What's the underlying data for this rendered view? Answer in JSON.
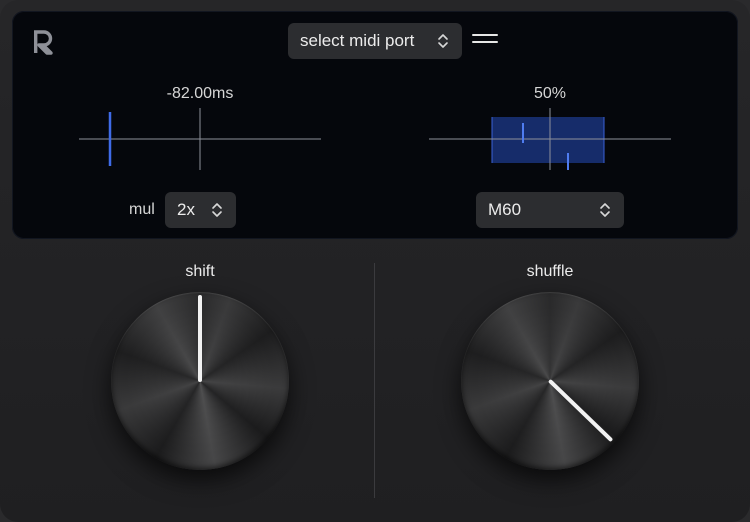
{
  "header": {
    "logo_text": "R",
    "midi_port": {
      "selected": "select midi port"
    },
    "menu_icon": "hamburger-icon"
  },
  "shift_panel": {
    "readout": "-82.00ms",
    "mul_label": "mul",
    "mul_value": "2x"
  },
  "shuffle_panel": {
    "readout": "50%",
    "preset_value": "M60"
  },
  "knobs": {
    "shift": {
      "title": "shift",
      "pointer_angle_deg": 0
    },
    "shuffle": {
      "title": "shuffle",
      "pointer_angle_deg": 134
    }
  },
  "colors": {
    "accent_blue": "#3f6be8",
    "display_bg": "#05070c",
    "panel_bg": "#232325",
    "shuffle_window": "#1c3a8a"
  }
}
